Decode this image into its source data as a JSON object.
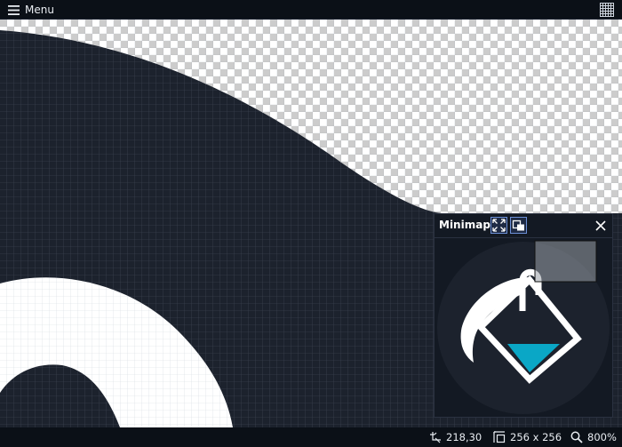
{
  "topbar": {
    "menu_label": "Menu",
    "menu_icon": "hamburger-icon",
    "grid_icon": "pixel-grid-icon"
  },
  "minimap": {
    "title": "Minimap",
    "fit_icon": "fit-to-screen-icon",
    "overlay_icon": "viewport-overlay-icon",
    "close_icon": "close-icon",
    "colors": {
      "disc": "#1c222d",
      "liquid": "#0aa7c6",
      "outline": "#ffffff"
    }
  },
  "status": {
    "cursor_position": "218,30",
    "image_size": "256 x 256",
    "zoom": "800%",
    "cursor_icon": "cursor-position-icon",
    "size_icon": "image-size-icon",
    "zoom_icon": "zoom-icon"
  },
  "colors": {
    "artwork_dark": "#1c222d",
    "artwork_light": "#ffffff",
    "background": "#0b1017"
  }
}
